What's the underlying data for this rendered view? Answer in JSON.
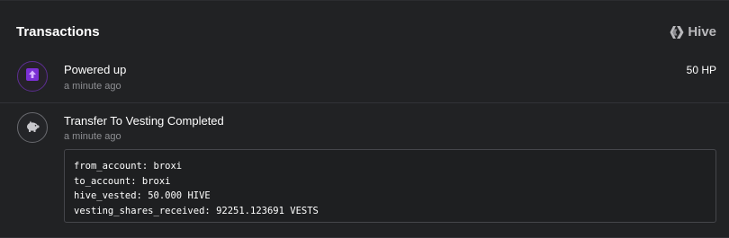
{
  "header": {
    "title": "Transactions",
    "brand_label": "Hive",
    "brand_icon": "hive-logo-icon"
  },
  "transactions": [
    {
      "title": "Powered up",
      "time": "a minute ago",
      "amount": "50 HP",
      "icon": "arrow-up-icon",
      "accent": "#7b2fd4"
    },
    {
      "title": "Transfer To Vesting Completed",
      "time": "a minute ago",
      "icon": "piggy-bank-icon",
      "details": [
        {
          "key": "from_account",
          "value": "broxi"
        },
        {
          "key": "to_account",
          "value": "broxi"
        },
        {
          "key": "hive_vested",
          "value": "50.000 HIVE"
        },
        {
          "key": "vesting_shares_received",
          "value": "92251.123691 VESTS"
        }
      ]
    }
  ],
  "colors": {
    "background": "#212224",
    "powerup_accent": "#7b2fd4",
    "muted_text": "#8e8f93"
  }
}
